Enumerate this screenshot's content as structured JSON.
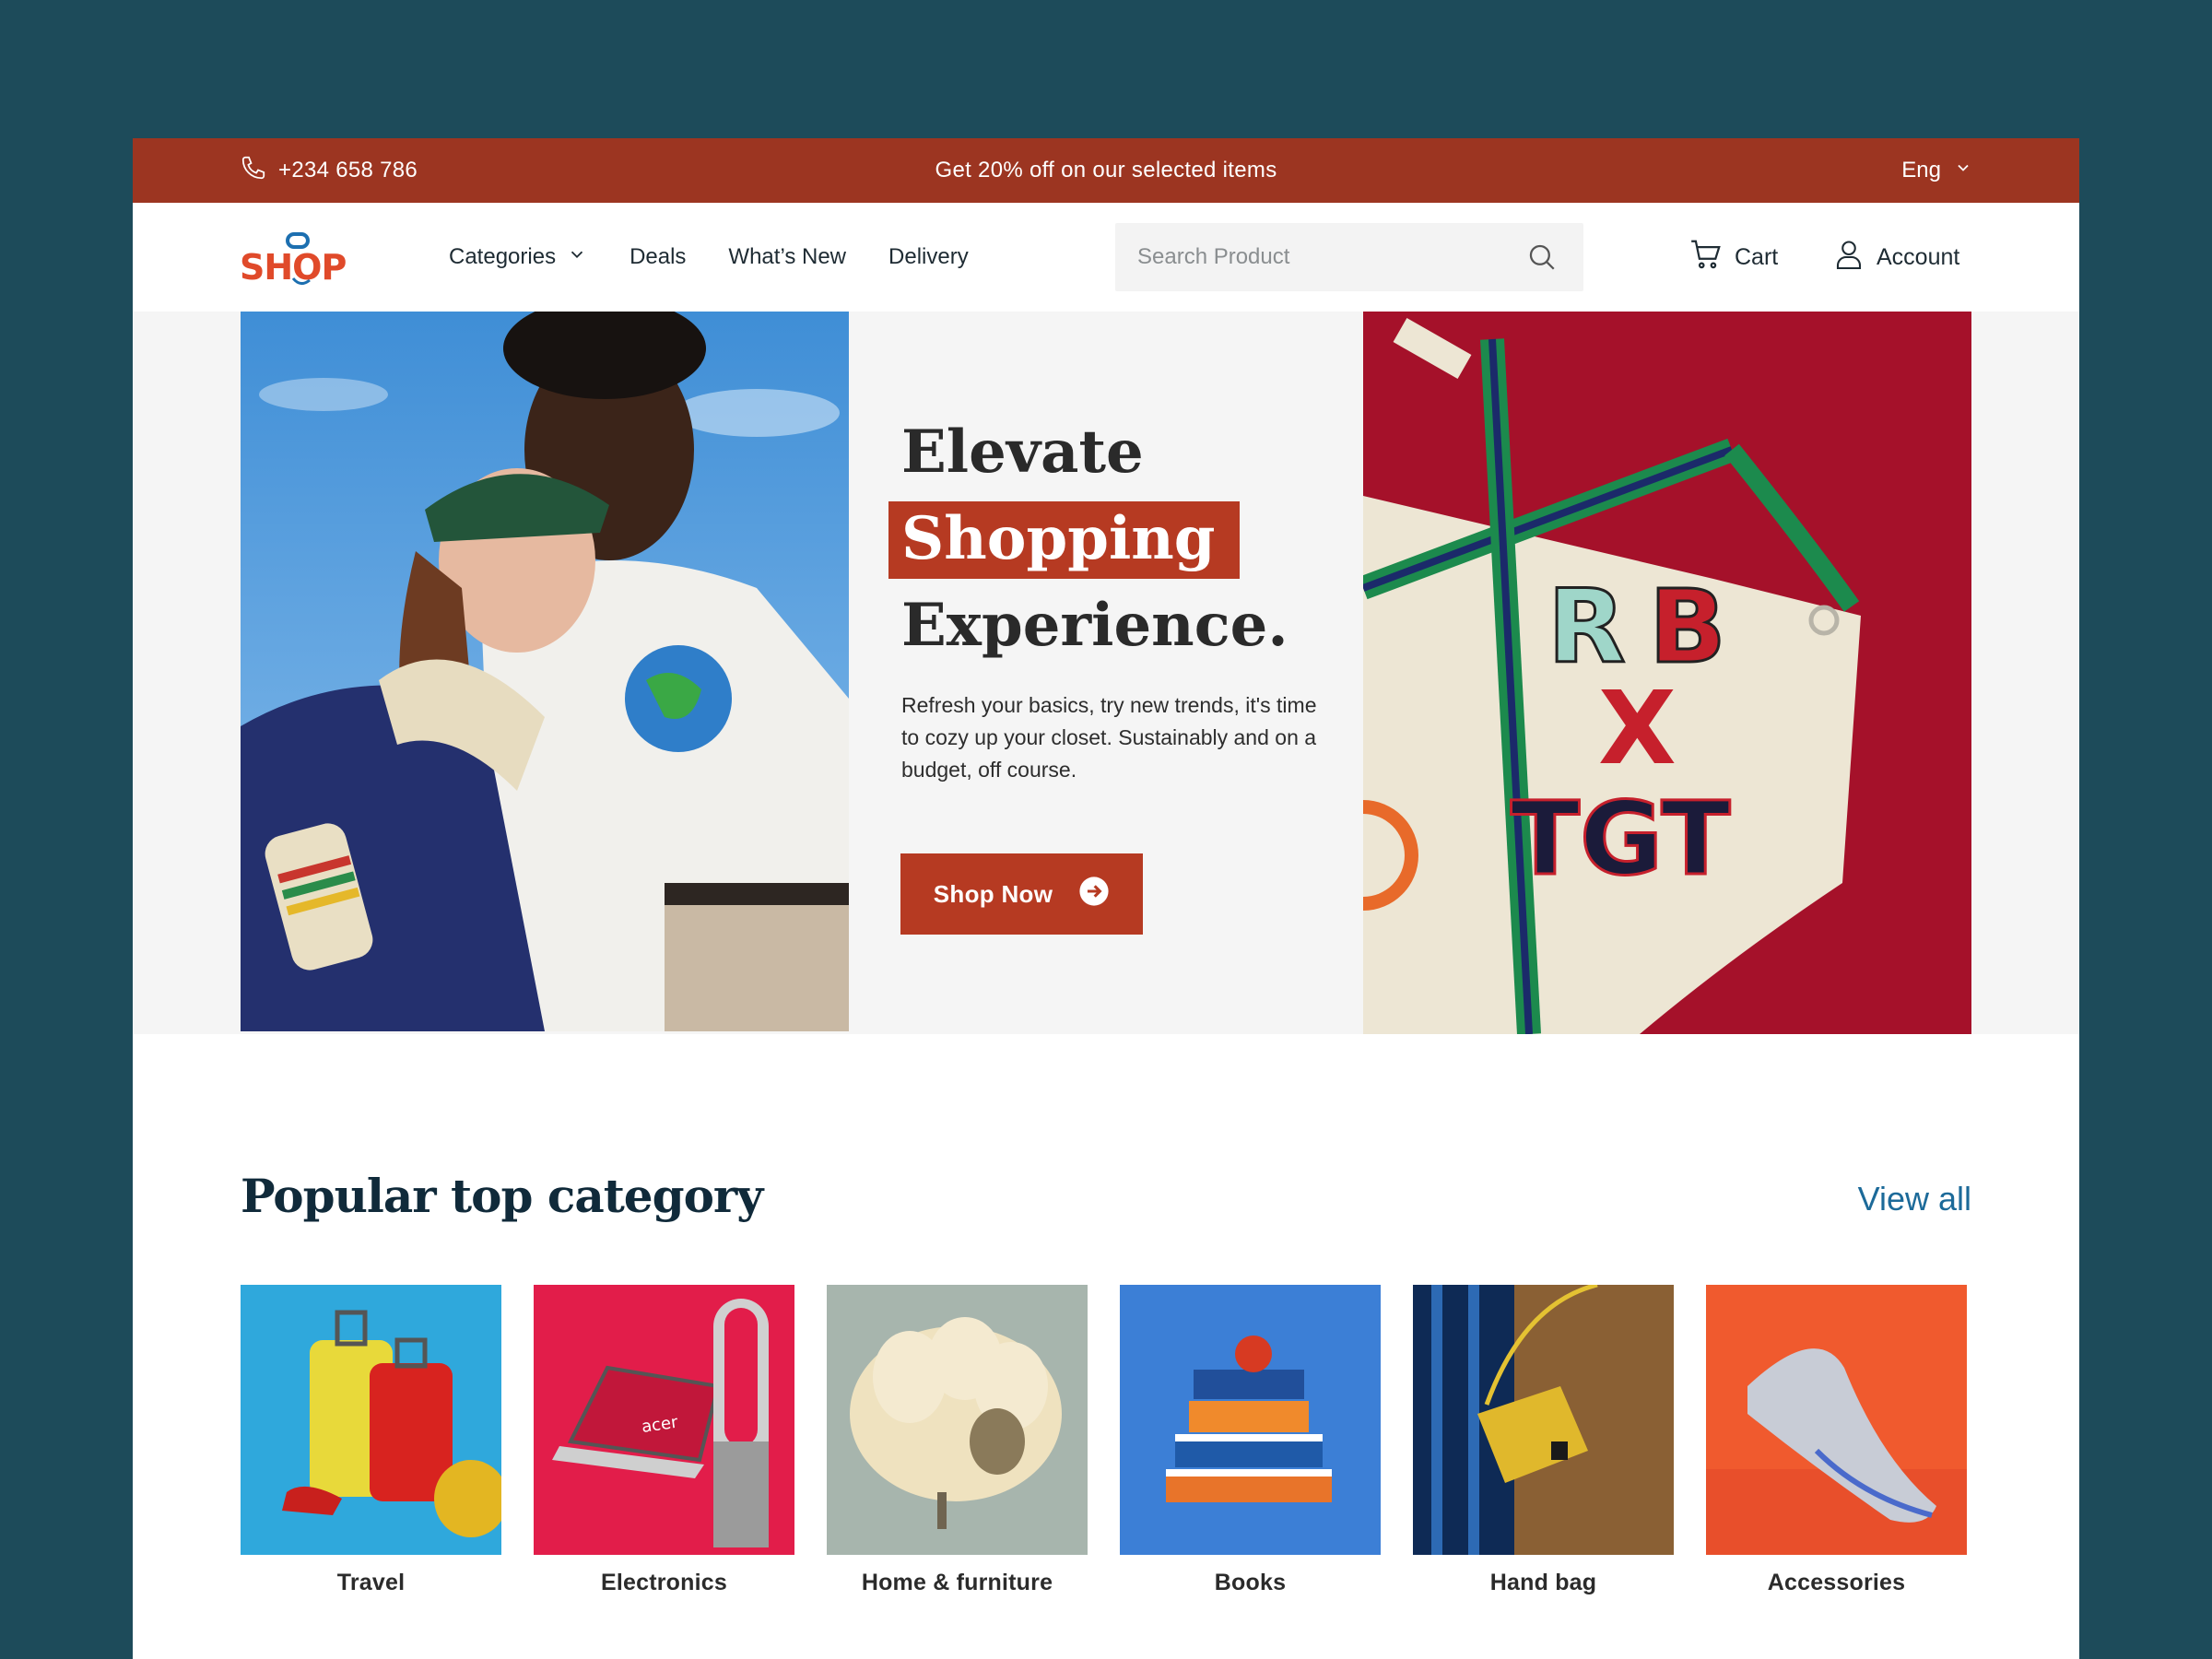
{
  "topbar": {
    "phone": "+234 658 786",
    "promo": "Get 20% off on our selected items",
    "language": "Eng"
  },
  "nav": {
    "logo": "SHOP",
    "menu": {
      "categories": "Categories",
      "deals": "Deals",
      "whats_new": "What’s New",
      "delivery": "Delivery"
    },
    "search_placeholder": "Search Product",
    "cart": "Cart",
    "account": "Account"
  },
  "hero": {
    "line1": "Elevate",
    "line2": "Shopping",
    "line3": "Experience.",
    "description": "Refresh your basics, try new trends, it's time to cozy up your closet. Sustainably and on a budget, off course.",
    "cta": "Shop Now"
  },
  "popular": {
    "title": "Popular top category",
    "view_all": "View all",
    "categories": [
      {
        "label": "Travel"
      },
      {
        "label": "Electronics"
      },
      {
        "label": "Home & furniture"
      },
      {
        "label": "Books"
      },
      {
        "label": "Hand bag"
      },
      {
        "label": "Accessories"
      }
    ]
  },
  "colors": {
    "background": "#1d4b5a",
    "accent": "#9c3521",
    "button": "#b63a22",
    "link": "#1c6a99"
  },
  "icons": [
    "phone-icon",
    "chevron-down-icon",
    "search-icon",
    "cart-icon",
    "user-icon",
    "arrow-right-circle-icon"
  ]
}
